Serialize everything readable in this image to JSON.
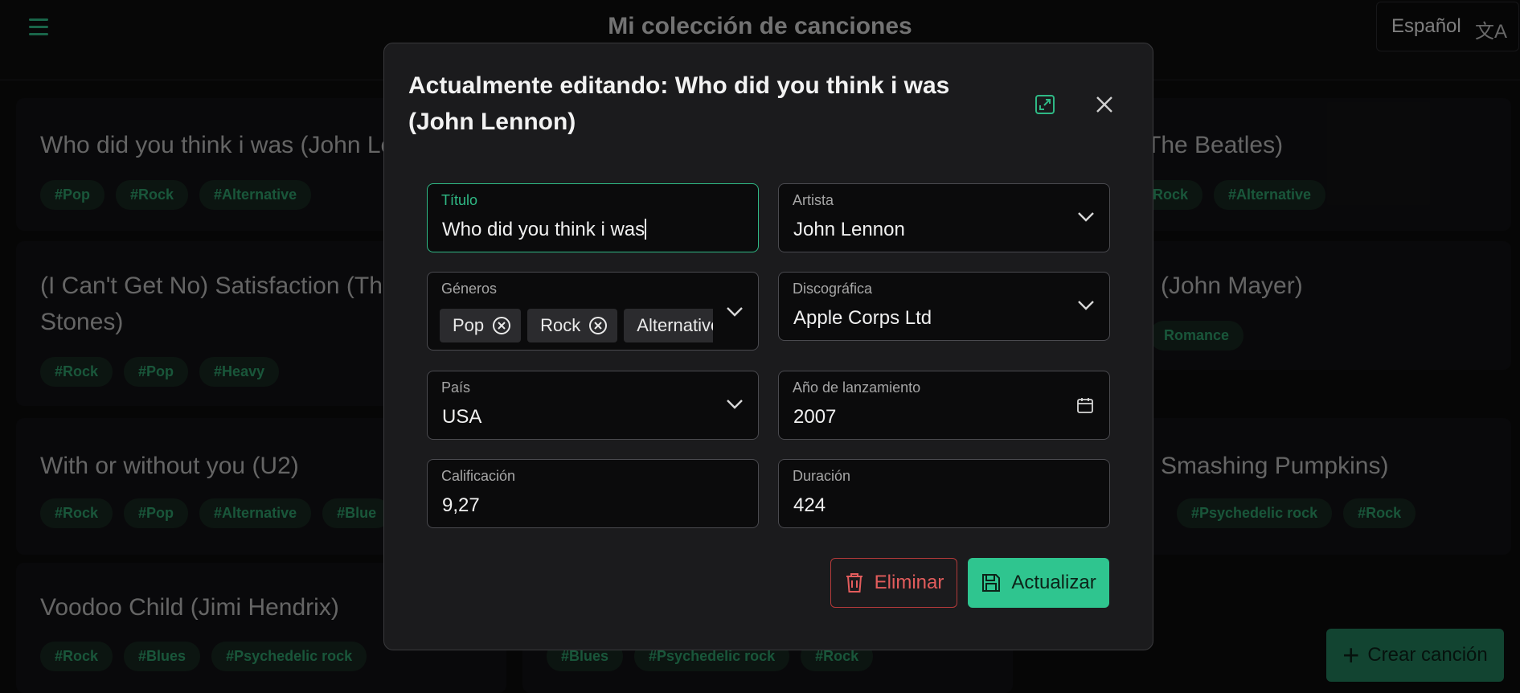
{
  "header": {
    "title": "Mi colección de canciones",
    "language": "Español",
    "language_icon": "translate-icon"
  },
  "cards": [
    {
      "title": "Who did you think i was (John Lennon)",
      "tags": [
        "#Pop",
        "#Rock",
        "#Alternative"
      ]
    },
    {
      "title": "(The Beatles)",
      "tags": [
        "Rock",
        "#Alternative"
      ]
    },
    {
      "title": "(I Can't Get No) Satisfaction (The",
      "title2": "Stones)",
      "tags": [
        "#Rock",
        "#Pop",
        "#Heavy"
      ]
    },
    {
      "title": "(John Mayer)",
      "tags": [
        "Romance"
      ]
    },
    {
      "title": "With or without you (U2)",
      "tags": [
        "#Rock",
        "#Pop",
        "#Alternative",
        "#Blue"
      ]
    },
    {
      "title": "Smashing Pumpkins)",
      "tags": [
        "#Psychedelic rock",
        "#Rock"
      ]
    },
    {
      "title": "Voodoo Child (Jimi Hendrix)",
      "tags": [
        "#Rock",
        "#Blues",
        "#Psychedelic rock"
      ]
    },
    {
      "title": "",
      "tags": [
        "#Blues",
        "#Psychedelic rock",
        "#Rock"
      ]
    }
  ],
  "fab": {
    "label": "Crear canción"
  },
  "modal": {
    "title": "Actualmente editando: Who did you think i was (John Lennon)",
    "fields": {
      "titulo": {
        "label": "Título",
        "value": "Who did you think i was"
      },
      "artista": {
        "label": "Artista",
        "value": "John Lennon"
      },
      "generos": {
        "label": "Géneros",
        "chips": [
          "Pop",
          "Rock",
          "Alternative"
        ]
      },
      "discografica": {
        "label": "Discográfica",
        "value": "Apple Corps Ltd"
      },
      "pais": {
        "label": "País",
        "value": "USA"
      },
      "anio": {
        "label": "Año de lanzamiento",
        "value": "2007"
      },
      "calificacion": {
        "label": "Calificación",
        "value": "9,27"
      },
      "duracion": {
        "label": "Duración",
        "value": "424"
      }
    },
    "delete_label": "Eliminar",
    "update_label": "Actualizar"
  },
  "colors": {
    "accent": "#2fb985",
    "danger": "#e25c5c"
  }
}
